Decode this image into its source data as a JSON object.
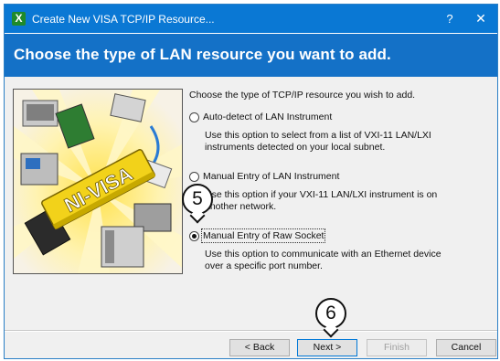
{
  "window": {
    "title": "Create New VISA TCP/IP Resource...",
    "app_icon_glyph": "X",
    "help_glyph": "?",
    "close_glyph": "✕"
  },
  "header": {
    "title": "Choose the type of LAN resource you want to add."
  },
  "illustration": {
    "logo_text": "NI-VISA"
  },
  "content": {
    "intro": "Choose the type of TCP/IP resource you wish to add.",
    "options": [
      {
        "label": "Auto-detect of LAN Instrument",
        "desc_line1": "Use this option to select from a list of VXI-11 LAN/LXI",
        "desc_line2": "instruments detected on your local subnet.",
        "selected": false
      },
      {
        "label": "Manual Entry of LAN Instrument",
        "desc_line1": "Use this option if your VXI-11 LAN/LXI instrument is on",
        "desc_line2": "another network.",
        "selected": false
      },
      {
        "label": "Manual Entry of Raw Socket",
        "desc_line1": "Use this option to communicate with an Ethernet device",
        "desc_line2": "over a specific port number.",
        "selected": true
      }
    ]
  },
  "buttons": {
    "back": "< Back",
    "next": "Next >",
    "finish": "Finish",
    "cancel": "Cancel"
  },
  "callouts": {
    "step5": "5",
    "step6": "6"
  },
  "colors": {
    "titlebar": "#0a78d4",
    "header_band": "#1471c7",
    "logo_yellow": "#f2d21a"
  }
}
